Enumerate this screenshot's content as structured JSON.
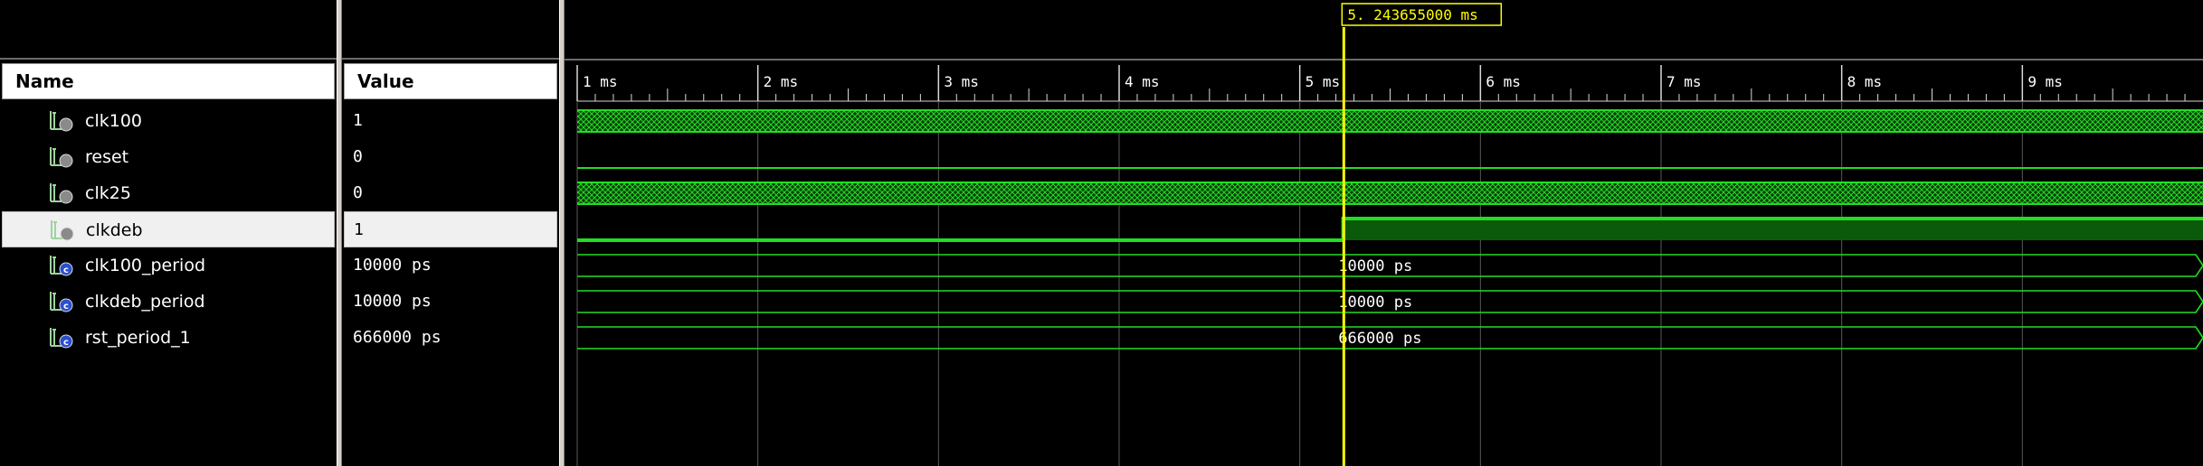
{
  "columns": {
    "name": "Name",
    "value": "Value"
  },
  "cursor": {
    "readout": "5. 243655000  ms",
    "time_ms": 5.2437
  },
  "timeline": {
    "ticks": [
      {
        "ms": 1,
        "label": "1 ms"
      },
      {
        "ms": 2,
        "label": "2 ms"
      },
      {
        "ms": 3,
        "label": "3 ms"
      },
      {
        "ms": 4,
        "label": "4 ms"
      },
      {
        "ms": 5,
        "label": "5 ms"
      },
      {
        "ms": 6,
        "label": "6 ms"
      },
      {
        "ms": 7,
        "label": "7 ms"
      },
      {
        "ms": 8,
        "label": "8 ms"
      },
      {
        "ms": 9,
        "label": "9 ms"
      }
    ],
    "start_ms": 1.0,
    "end_ms": 10.0
  },
  "signals": [
    {
      "name": "clk100",
      "value": "1",
      "kind": "clock",
      "icon": "bit-signal-icon"
    },
    {
      "name": "reset",
      "value": "0",
      "kind": "low",
      "icon": "bit-signal-icon"
    },
    {
      "name": "clk25",
      "value": "0",
      "kind": "clock",
      "icon": "bit-signal-icon"
    },
    {
      "name": "clkdeb",
      "value": "1",
      "kind": "step",
      "step_ms": 5.24,
      "icon": "bit-signal-icon"
    },
    {
      "name": "clk100_period",
      "value": "10000 ps",
      "kind": "bus",
      "bus_label": "10000 ps",
      "icon": "constant-signal-icon"
    },
    {
      "name": "clkdeb_period",
      "value": "10000 ps",
      "kind": "bus",
      "bus_label": "10000 ps",
      "icon": "constant-signal-icon"
    },
    {
      "name": "rst_period_1",
      "value": "666000 ps",
      "kind": "bus",
      "bus_label": "666000 ps",
      "icon": "constant-signal-icon"
    }
  ],
  "selected_signal": "clkdeb",
  "colors": {
    "wave": "#22dd22",
    "wave_fill": "#0b5a0b",
    "cursor": "#ffff00",
    "grid": "#d9d9d9",
    "selected_row": "#f0f0f0"
  }
}
